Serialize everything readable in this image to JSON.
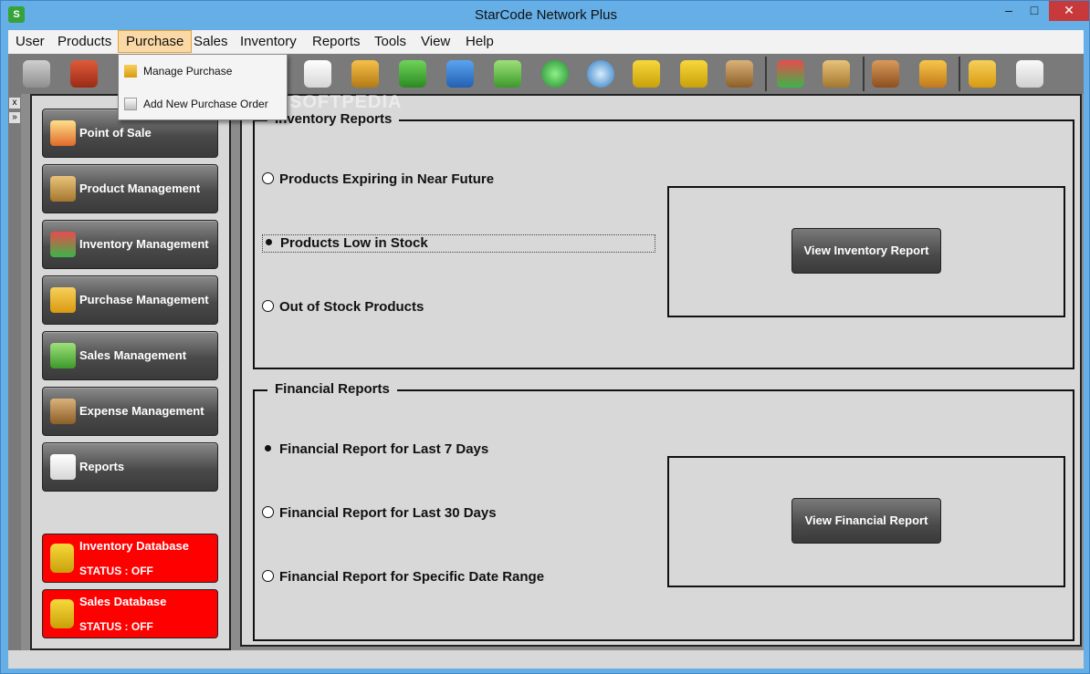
{
  "window": {
    "title": "StarCode Network Plus",
    "app_icon": "S",
    "min": "–",
    "max": "□",
    "close": "✕"
  },
  "menu": {
    "items": [
      {
        "label": "User"
      },
      {
        "label": "Products"
      },
      {
        "label": "Purchase",
        "active": true
      },
      {
        "label": "Sales"
      },
      {
        "label": "Inventory"
      },
      {
        "label": "Reports"
      },
      {
        "label": "Tools"
      },
      {
        "label": "View"
      },
      {
        "label": "Help"
      }
    ],
    "dropdown": [
      {
        "label": "Manage Purchase",
        "icon": "purchase-list-icon"
      },
      {
        "label": "Add New Purchase Order",
        "icon": "purchase-order-icon"
      }
    ]
  },
  "toolbar": {
    "icons": [
      "login-icon",
      "logout-icon",
      "report-icon",
      "users-icon",
      "delivery-truck-icon",
      "customers-icon",
      "sales-growth-icon",
      "database-icon",
      "settings-icon",
      "add-database-icon",
      "database-stack-icon",
      "wallet-icon",
      "inventory-icon",
      "boxes-icon",
      "product-icon",
      "open-box-icon",
      "purchase-list-icon",
      "purchase-order-icon"
    ]
  },
  "side_strip": {
    "close": "x",
    "pin": "»"
  },
  "sidebar": {
    "buttons": [
      {
        "label": "Point of Sale",
        "icon": "point-of-sale-icon"
      },
      {
        "label": "Product Management",
        "icon": "product-box-icon"
      },
      {
        "label": "Inventory Management",
        "icon": "inventory-blocks-icon"
      },
      {
        "label": "Purchase Management",
        "icon": "purchase-list-icon"
      },
      {
        "label": "Sales Management",
        "icon": "sales-growth-icon"
      },
      {
        "label": "Expense Management",
        "icon": "wallet-icon"
      },
      {
        "label": "Reports",
        "icon": "report-icon"
      }
    ],
    "databases": [
      {
        "name": "Inventory Database",
        "status": "STATUS : OFF"
      },
      {
        "name": "Sales Database",
        "status": "STATUS : OFF"
      }
    ]
  },
  "inventory_reports": {
    "title": "Inventory Reports",
    "options": [
      {
        "label": "Products Expiring in Near Future",
        "selected": false
      },
      {
        "label": "Products Low in Stock",
        "selected": true
      },
      {
        "label": "Out of Stock Products",
        "selected": false
      }
    ],
    "button": "View Inventory Report"
  },
  "financial_reports": {
    "title": "Financial Reports",
    "options": [
      {
        "label": "Financial Report for Last 7 Days",
        "selected": true
      },
      {
        "label": "Financial Report for Last 30 Days",
        "selected": false
      },
      {
        "label": "Financial Report for Specific Date Range",
        "selected": false
      }
    ],
    "button": "View Financial Report"
  },
  "watermark": "SOFTPEDIA",
  "colors": {
    "db_off": "#ff0000",
    "menu_active": "#fbd9a6",
    "close": "#c7393a"
  }
}
